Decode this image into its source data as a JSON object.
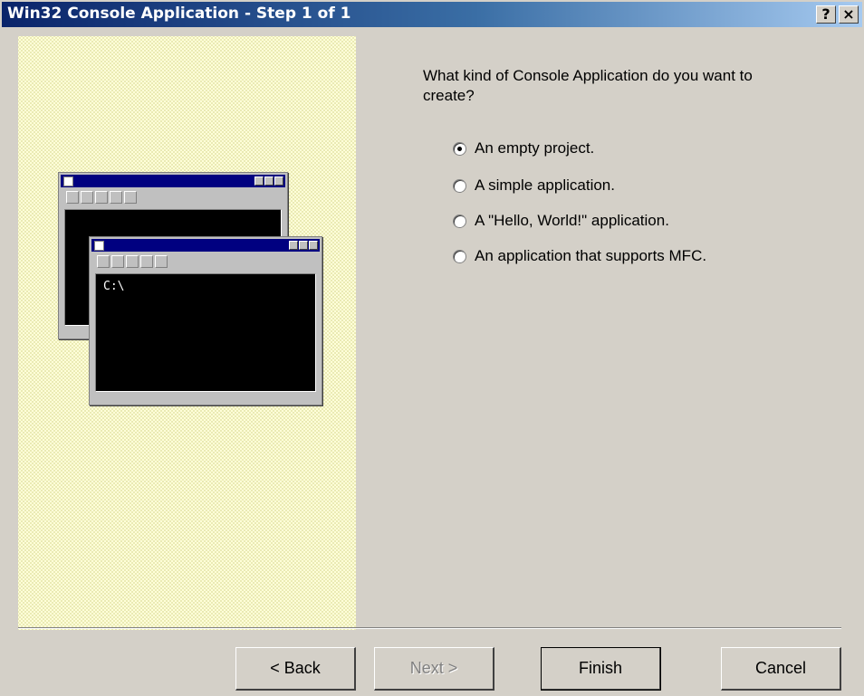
{
  "window": {
    "title": "Win32 Console Application - Step 1 of 1",
    "help_button": "?",
    "close_button": "×"
  },
  "illustration": {
    "prompt_text": "C:\\"
  },
  "main": {
    "question": "What kind of Console Application do you want to create?",
    "options": [
      {
        "label": "An empty project.",
        "selected": true
      },
      {
        "label": "A simple application.",
        "selected": false
      },
      {
        "label": "A \"Hello, World!\" application.",
        "selected": false
      },
      {
        "label": "An application that supports MFC.",
        "selected": false
      }
    ]
  },
  "buttons": {
    "back": "< Back",
    "next": "Next >",
    "finish": "Finish",
    "cancel": "Cancel"
  },
  "colors": {
    "title_bar_start": "#0a246a",
    "dialog_face": "#d4d0c8",
    "illustration_bg": "#ffffd9"
  }
}
